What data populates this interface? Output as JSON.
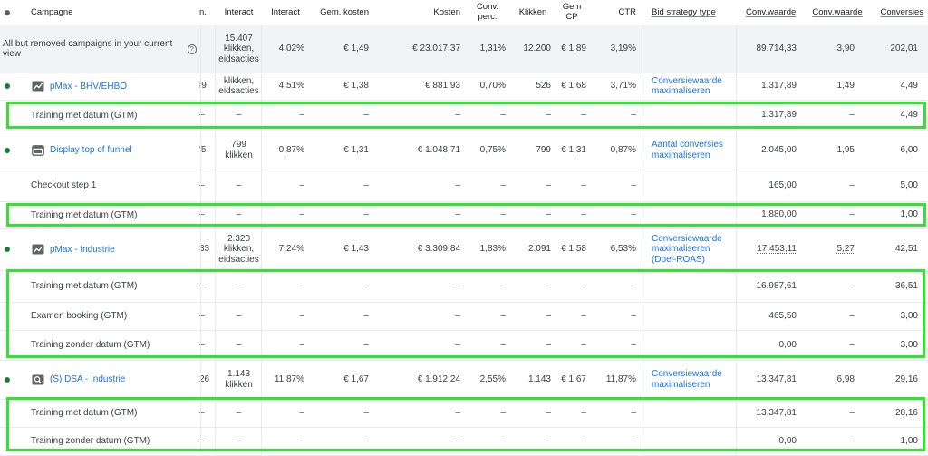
{
  "header": {
    "campaign": "Campagne",
    "cut": "n.",
    "interact1": "Interact",
    "interact2": "Interact",
    "gem_kosten": "Gem. kosten",
    "kosten": "Kosten",
    "conv_perc": "Conv. perc.",
    "klikken": "Klikken",
    "gem_cp": "Gem CP",
    "ctr": "CTR",
    "bid_strategy": "Bid strategy type",
    "conv_waarde1": "Conv.waarde",
    "conv_waarde2": "Conv.waarde",
    "conversies": "Conversies"
  },
  "total": {
    "label": "All but removed campaigns in your current view",
    "cut": "",
    "interact1": "15.407 klikken, eidsacties",
    "interact2": "4,02%",
    "gem_kosten": "€ 1,49",
    "kosten": "€ 23.017,37",
    "conv_perc": "1,31%",
    "klikken": "12.200",
    "gem_cp": "€ 1,89",
    "ctr": "3,19%",
    "bid": "",
    "conv_waarde1": "89.714,33",
    "conv_waarde2": "3,90",
    "conversies": "202,01"
  },
  "rows": [
    {
      "type": "campaign",
      "icon": "pmax",
      "name": "pMax - BHV/EHBO",
      "cut": "i9",
      "interact1": "klikken, eidsacties",
      "interact2": "4,51%",
      "gem_kosten": "€ 1,38",
      "kosten": "€ 881,93",
      "conv_perc": "0,70%",
      "klikken": "526",
      "gem_cp": "€ 1,68",
      "ctr": "3,71%",
      "bid": "Conversiewaarde maximaliseren",
      "conv_waarde1": "1.317,89",
      "conv_waarde2": "1,49",
      "conversies": "4,49"
    },
    {
      "type": "sub",
      "name": "Training met datum (GTM)",
      "cut": "–",
      "interact1": "–",
      "interact2": "–",
      "gem_kosten": "–",
      "kosten": "–",
      "conv_perc": "–",
      "klikken": "–",
      "gem_cp": "–",
      "ctr": "–",
      "bid": "",
      "conv_waarde1": "1.317,89",
      "conv_waarde2": "–",
      "conversies": "4,49"
    },
    {
      "type": "campaign",
      "icon": "display",
      "name": "Display top of funnel",
      "cut": "'5",
      "interact1": "799 klikken",
      "interact2": "0,87%",
      "gem_kosten": "€ 1,31",
      "kosten": "€ 1.048,71",
      "conv_perc": "0,75%",
      "klikken": "799",
      "gem_cp": "€ 1,31",
      "ctr": "0,87%",
      "bid": "Aantal conversies maximaliseren",
      "conv_waarde1": "2.045,00",
      "conv_waarde2": "1,95",
      "conversies": "6,00"
    },
    {
      "type": "sub",
      "name": "Checkout step 1",
      "cut": "–",
      "interact1": "–",
      "interact2": "–",
      "gem_kosten": "–",
      "kosten": "–",
      "conv_perc": "–",
      "klikken": "–",
      "gem_cp": "–",
      "ctr": "–",
      "bid": "",
      "conv_waarde1": "165,00",
      "conv_waarde2": "–",
      "conversies": "5,00"
    },
    {
      "type": "sub",
      "name": "Training met datum (GTM)",
      "cut": "–",
      "interact1": "–",
      "interact2": "–",
      "gem_kosten": "–",
      "kosten": "–",
      "conv_perc": "–",
      "klikken": "–",
      "gem_cp": "–",
      "ctr": "–",
      "bid": "",
      "conv_waarde1": "1.880,00",
      "conv_waarde2": "–",
      "conversies": "1,00"
    },
    {
      "type": "campaign",
      "icon": "pmax",
      "name": "pMax - Industrie",
      "cut": "33",
      "interact1": "2.320 klikken, eidsacties",
      "interact2": "7,24%",
      "gem_kosten": "€ 1,43",
      "kosten": "€ 3.309,84",
      "conv_perc": "1,83%",
      "klikken": "2.091",
      "gem_cp": "€ 1,58",
      "ctr": "6,53%",
      "bid": "Conversiewaarde maximaliseren (Doel-ROAS)",
      "conv_waarde1": "17.453,11",
      "conv_waarde2": "5,27",
      "conversies": "42,51"
    },
    {
      "type": "sub",
      "name": "Training met datum (GTM)",
      "cut": "–",
      "interact1": "–",
      "interact2": "–",
      "gem_kosten": "–",
      "kosten": "–",
      "conv_perc": "–",
      "klikken": "–",
      "gem_cp": "–",
      "ctr": "–",
      "bid": "",
      "conv_waarde1": "16.987,61",
      "conv_waarde2": "–",
      "conversies": "36,51"
    },
    {
      "type": "sub",
      "name": "Examen booking (GTM)",
      "cut": "–",
      "interact1": "–",
      "interact2": "–",
      "gem_kosten": "–",
      "kosten": "–",
      "conv_perc": "–",
      "klikken": "–",
      "gem_cp": "–",
      "ctr": "–",
      "bid": "",
      "conv_waarde1": "465,50",
      "conv_waarde2": "–",
      "conversies": "3,00"
    },
    {
      "type": "sub",
      "name": "Training zonder datum (GTM)",
      "cut": "–",
      "interact1": "–",
      "interact2": "–",
      "gem_kosten": "–",
      "kosten": "–",
      "conv_perc": "–",
      "klikken": "–",
      "gem_cp": "–",
      "ctr": "–",
      "bid": "",
      "conv_waarde1": "0,00",
      "conv_waarde2": "–",
      "conversies": "3,00"
    },
    {
      "type": "campaign",
      "icon": "search",
      "name": "(S) DSA - Industrie",
      "cut": "26",
      "interact1": "1.143 klikken",
      "interact2": "11,87%",
      "gem_kosten": "€ 1,67",
      "kosten": "€ 1.912,24",
      "conv_perc": "2,55%",
      "klikken": "1.143",
      "gem_cp": "€ 1,67",
      "ctr": "11,87%",
      "bid": "Conversiewaarde maximaliseren",
      "conv_waarde1": "13.347,81",
      "conv_waarde2": "6,98",
      "conversies": "29,16"
    },
    {
      "type": "sub",
      "name": "Training met datum (GTM)",
      "cut": "–",
      "interact1": "–",
      "interact2": "–",
      "gem_kosten": "–",
      "kosten": "–",
      "conv_perc": "–",
      "klikken": "–",
      "gem_cp": "–",
      "ctr": "–",
      "bid": "",
      "conv_waarde1": "13.347,81",
      "conv_waarde2": "–",
      "conversies": "28,16"
    },
    {
      "type": "sub",
      "name": "Training zonder datum (GTM)",
      "cut": "–",
      "interact1": "–",
      "interact2": "–",
      "gem_kosten": "–",
      "kosten": "–",
      "conv_perc": "–",
      "klikken": "–",
      "gem_cp": "–",
      "ctr": "–",
      "bid": "",
      "conv_waarde1": "0,00",
      "conv_waarde2": "–",
      "conversies": "1,00"
    }
  ],
  "colors": {
    "highlight": "#2ee62e",
    "link": "#1a73e8",
    "status_dot": "#188038"
  }
}
